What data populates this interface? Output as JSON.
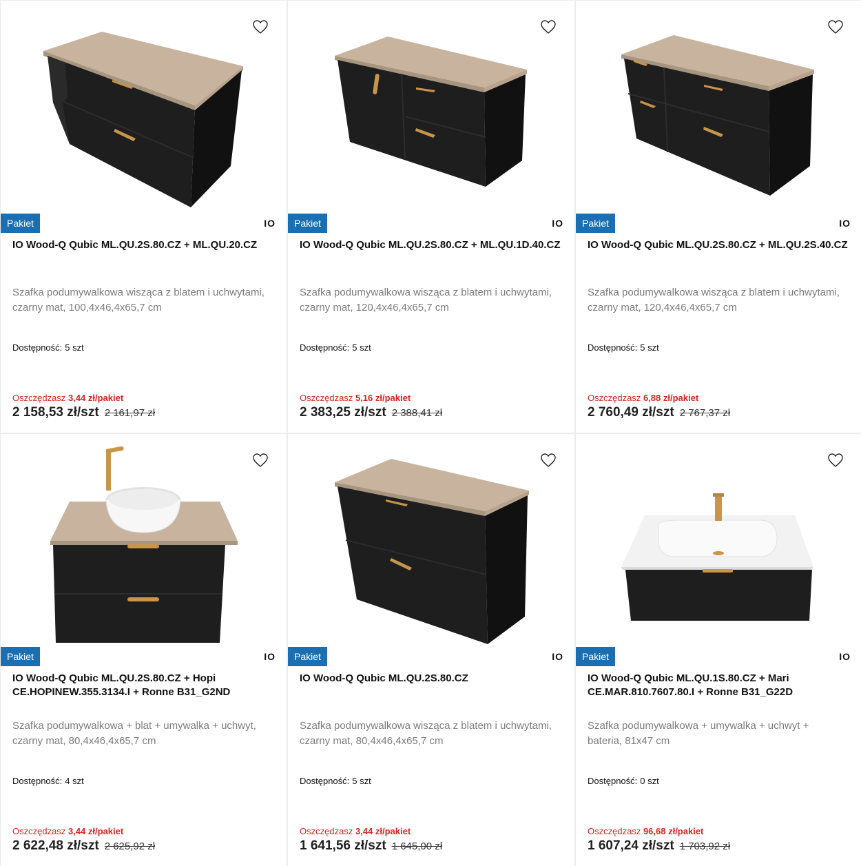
{
  "products": [
    {
      "badge": "Pakiet",
      "brand": "IO",
      "title": "IO Wood-Q Qubic ML.QU.2S.80.CZ + ML.QU.20.CZ",
      "description": "Szafka podumywalkowa wisząca z blatem i uchwytami, czarny mat, 100,4x46,4x65,7 cm",
      "availability_label": "Dostępność:",
      "availability": "5 szt",
      "savings_label": "Oszczędzasz",
      "savings": "3,44 zł/pakiet",
      "price": "2 158,53 zł/szt",
      "old_price": "2 161,97 zł",
      "image_icon": "cabinet-two-drawers-open-shelf"
    },
    {
      "badge": "Pakiet",
      "brand": "IO",
      "title": "IO Wood-Q Qubic ML.QU.2S.80.CZ + ML.QU.1D.40.CZ",
      "description": "Szafka podumywalkowa wisząca z blatem i uchwytami, czarny mat, 120,4x46,4x65,7 cm",
      "availability_label": "Dostępność:",
      "availability": "5 szt",
      "savings_label": "Oszczędzasz",
      "savings": "5,16 zł/pakiet",
      "price": "2 383,25 zł/szt",
      "old_price": "2 388,41 zł",
      "image_icon": "cabinet-door-and-drawers"
    },
    {
      "badge": "Pakiet",
      "brand": "IO",
      "title": "IO Wood-Q Qubic ML.QU.2S.80.CZ + ML.QU.2S.40.CZ",
      "description": "Szafka podumywalkowa wisząca z blatem i uchwytami, czarny mat, 120,4x46,4x65,7 cm",
      "availability_label": "Dostępność:",
      "availability": "5 szt",
      "savings_label": "Oszczędzasz",
      "savings": "6,88 zł/pakiet",
      "price": "2 760,49 zł/szt",
      "old_price": "2 767,37 zł",
      "image_icon": "cabinet-four-drawers"
    },
    {
      "badge": "Pakiet",
      "brand": "IO",
      "title": "IO Wood-Q Qubic ML.QU.2S.80.CZ + Hopi CE.HOPINEW.355.3134.I + Ronne B31_G2ND",
      "description": "Szafka podumywalkowa + blat + umywalka + uchwyt, czarny mat, 80,4x46,4x65,7 cm",
      "availability_label": "Dostępność:",
      "availability": "4 szt",
      "savings_label": "Oszczędzasz",
      "savings": "3,44 zł/pakiet",
      "price": "2 622,48 zł/szt",
      "old_price": "2 625,92 zł",
      "image_icon": "cabinet-with-bowl-basin-and-faucet"
    },
    {
      "badge": "Pakiet",
      "brand": "IO",
      "title": "IO Wood-Q Qubic ML.QU.2S.80.CZ",
      "description": "Szafka podumywalkowa wisząca z blatem i uchwytami, czarny mat, 80,4x46,4x65,7 cm",
      "availability_label": "Dostępność:",
      "availability": "5 szt",
      "savings_label": "Oszczędzasz",
      "savings": "3,44 zł/pakiet",
      "price": "1 641,56 zł/szt",
      "old_price": "1 645,00 zł",
      "image_icon": "cabinet-two-drawers"
    },
    {
      "badge": "Pakiet",
      "brand": "IO",
      "title": "IO Wood-Q Qubic ML.QU.1S.80.CZ + Mari CE.MAR.810.7607.80.I + Ronne B31_G22D",
      "description": "Szafka podumywalkowa + umywalka + uchwyt + bateria, 81x47 cm",
      "availability_label": "Dostępność:",
      "availability": "0 szt",
      "savings_label": "Oszczędzasz",
      "savings": "96,68 zł/pakiet",
      "price": "1 607,24 zł/szt",
      "old_price": "1 703,92 zł",
      "image_icon": "cabinet-with-integrated-basin"
    }
  ],
  "colors": {
    "badge": "#1a6fb3",
    "savings": "#d9241f",
    "cabinet": "#1c1c1c",
    "worktop": "#c8b39e",
    "handle": "#c9954a"
  }
}
